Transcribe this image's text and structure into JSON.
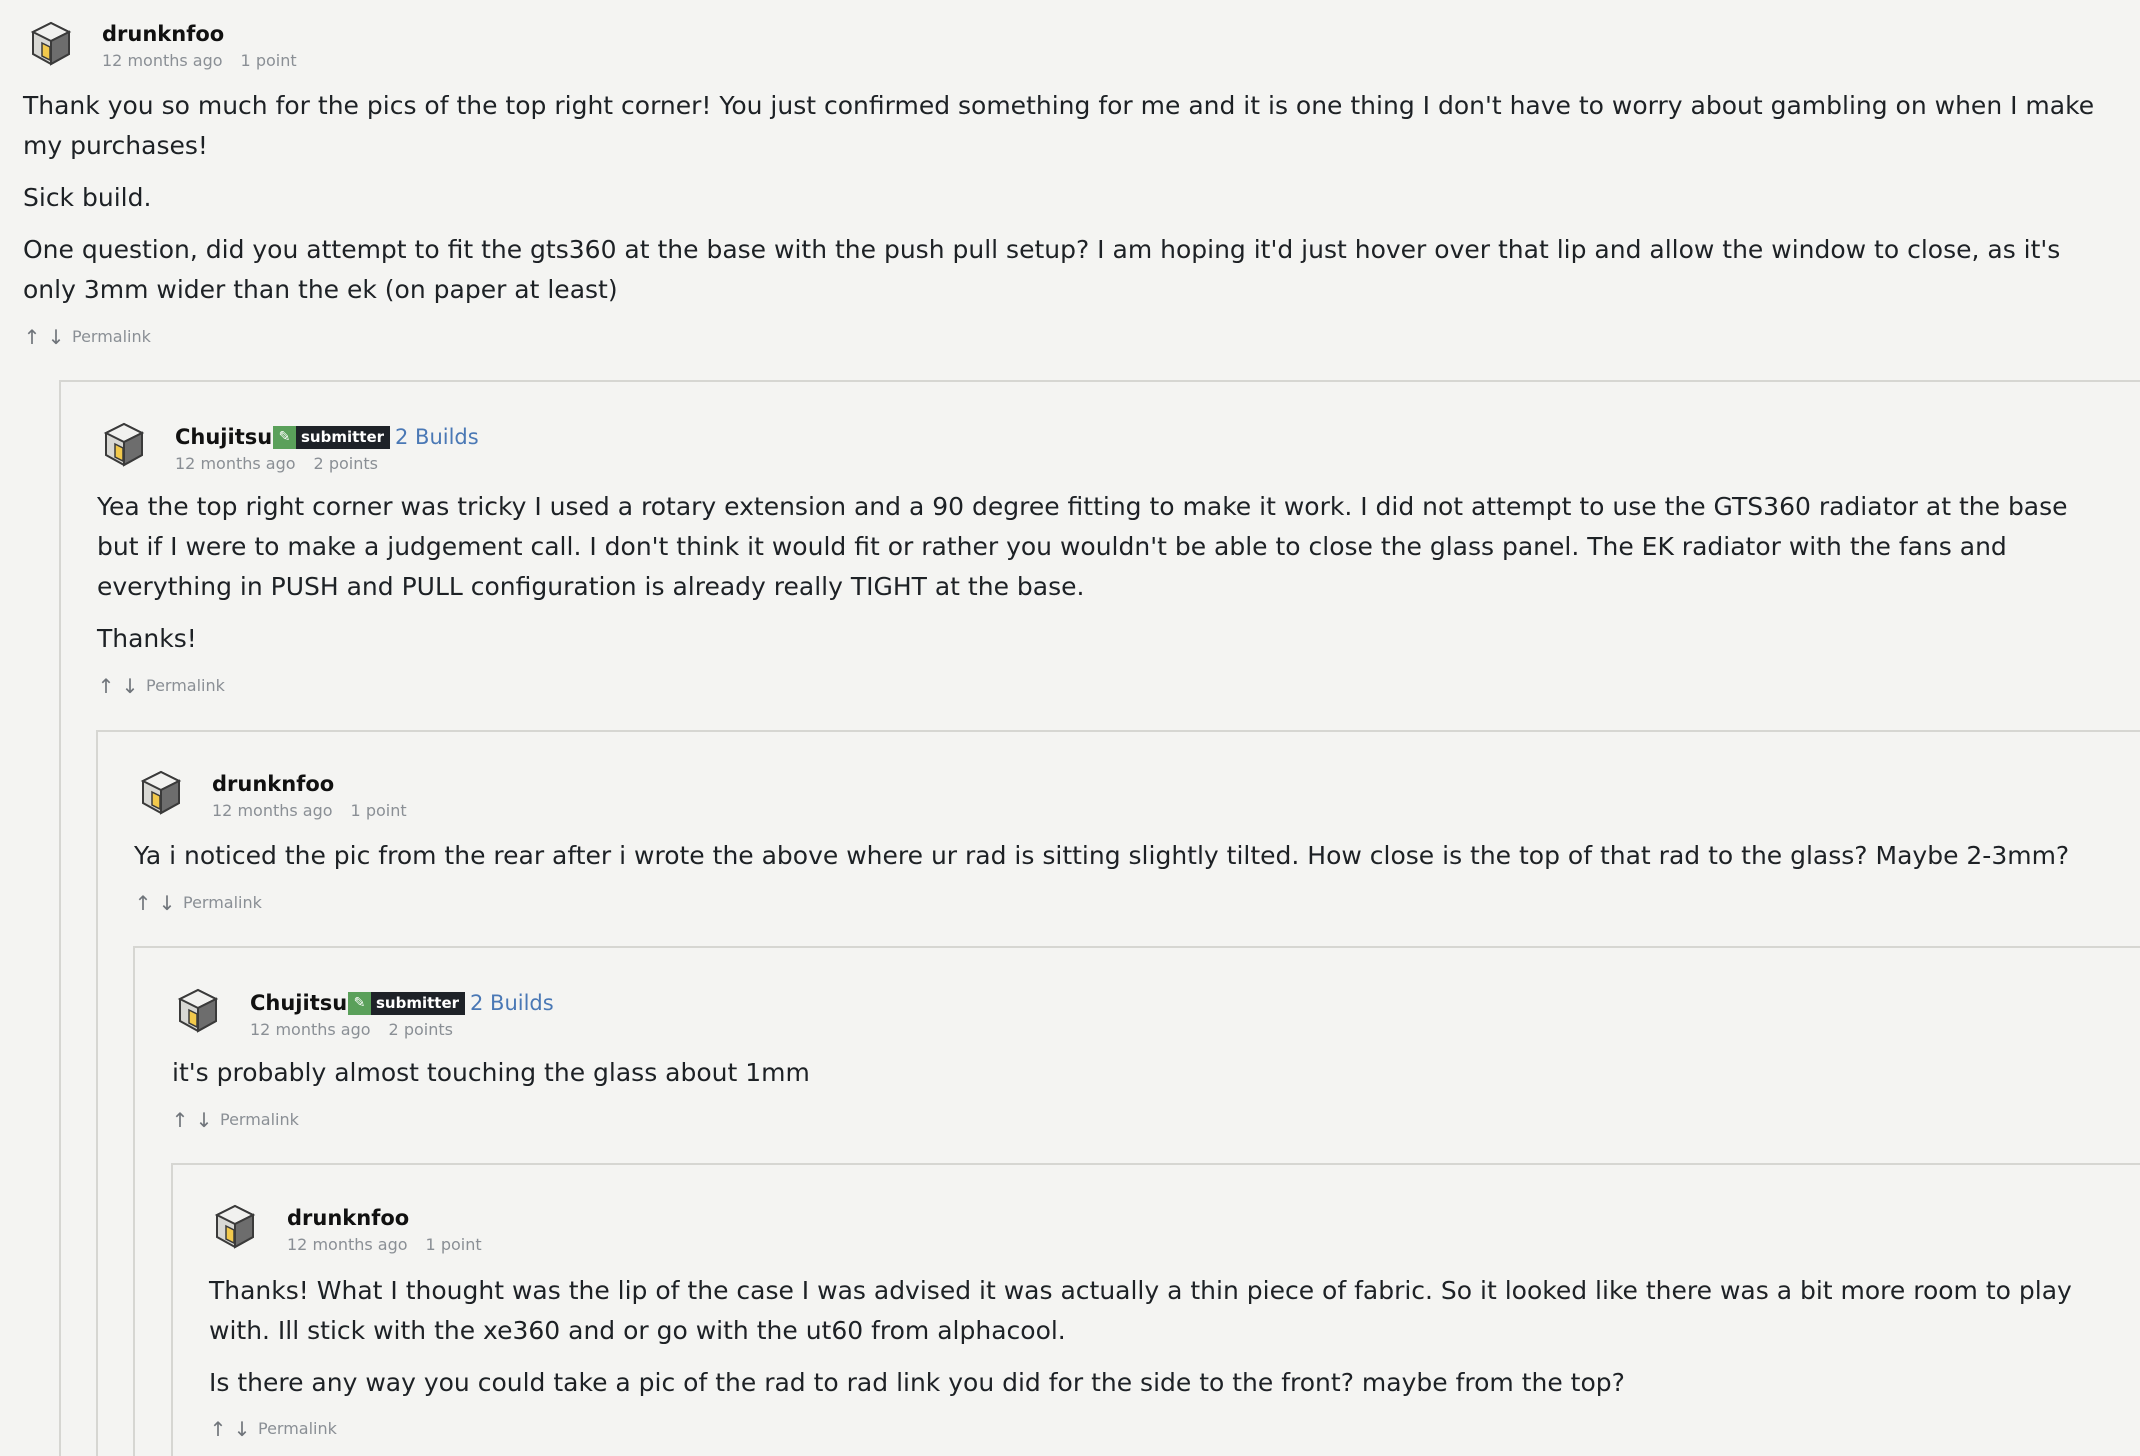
{
  "comments": [
    {
      "username": "drunknfoo",
      "time": "12 months ago",
      "points": "1 point",
      "paragraphs": [
        "Thank you so much for the pics of the top right corner! You just confirmed something for me and it is one thing I don't have to worry about gambling on when I make my purchases!",
        "Sick build.",
        "One question, did you attempt to fit the gts360 at the base with the push pull setup? I am hoping it'd just hover over that lip and allow the window to close, as it's only 3mm wider than the ek (on paper at least)"
      ],
      "permalink": "Permalink"
    },
    {
      "username": "Chujitsu",
      "badge": "submitter",
      "builds": "2 Builds",
      "time": "12 months ago",
      "points": "2 points",
      "paragraphs": [
        "Yea the top right corner was tricky I used a rotary extension and a 90 degree fitting to make it work. I did not attempt to use the GTS360 radiator at the base but if I were to make a judgement call. I don't think it would fit or rather you wouldn't be able to close the glass panel. The EK radiator with the fans and everything in PUSH and PULL configuration is already really TIGHT at the base.",
        "Thanks!"
      ],
      "permalink": "Permalink"
    },
    {
      "username": "drunknfoo",
      "time": "12 months ago",
      "points": "1 point",
      "paragraphs": [
        "Ya i noticed the pic from the rear after i wrote the above where ur rad is sitting slightly tilted. How close is the top of that rad to the glass? Maybe 2-3mm?"
      ],
      "permalink": "Permalink"
    },
    {
      "username": "Chujitsu",
      "badge": "submitter",
      "builds": "2 Builds",
      "time": "12 months ago",
      "points": "2 points",
      "paragraphs": [
        "it's probably almost touching the glass about 1mm"
      ],
      "permalink": "Permalink"
    },
    {
      "username": "drunknfoo",
      "time": "12 months ago",
      "points": "1 point",
      "paragraphs": [
        "Thanks! What I thought was the lip of the case I was advised it was actually a thin piece of fabric. So it looked like there was a bit more room to play with. Ill stick with the xe360 and or go with the ut60 from alphacool.",
        "Is there any way you could take a pic of the rad to rad link you did for the side to the front? maybe from the top?"
      ],
      "permalink": "Permalink"
    }
  ],
  "icons": {
    "upvote": "arrow-up-icon",
    "downvote": "arrow-down-icon",
    "badge": "pencil-icon",
    "avatar": "cube-avatar-icon"
  },
  "colors": {
    "background": "#f4f4f2",
    "link": "#4a78b5",
    "badge_green": "#5aa05a",
    "badge_dark": "#1e2228"
  }
}
